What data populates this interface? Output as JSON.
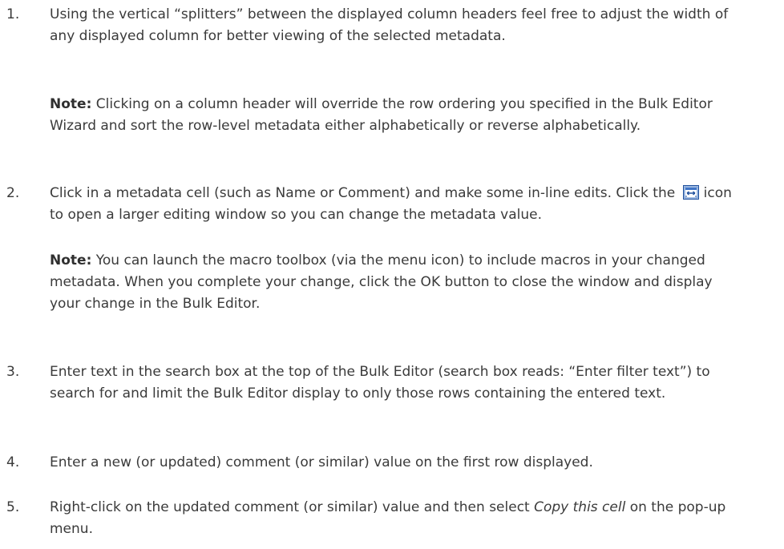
{
  "steps": [
    {
      "number": "1.",
      "text": "Using the vertical “splitters” between the displayed column headers feel free to adjust the width of any displayed column for better viewing of the selected metadata.",
      "note_label": "Note:",
      "note_text": " Clicking on a column header will override the row ordering you specified in the Bulk Editor Wizard and sort the row-level metadata either alphabetically or reverse alphabetically."
    },
    {
      "number": "2.",
      "text_before_icon": "Click in a metadata cell (such as Name or Comment) and make some in-line edits. Click the ",
      "icon": "expand-editor-icon",
      "text_after_icon": "icon to open a larger editing window so you can change the metadata value.",
      "note_label": "Note:",
      "note_text": " You can launch the macro toolbox (via the menu icon) to include macros in your changed metadata. When you complete your change, click the OK button to close the window and display your change in the Bulk Editor."
    },
    {
      "number": "3.",
      "text": "Enter text in the search box at the top of the Bulk Editor (search box reads: “Enter filter text”) to search for and limit the Bulk Editor display to only those rows containing the entered text."
    },
    {
      "number": "4.",
      "text": "Enter a new (or updated) comment (or similar) value on the first row displayed."
    },
    {
      "number": "5.",
      "text_before_italic": "Right-click on the updated comment (or similar) value and then select ",
      "italic": "Copy this cell",
      "text_after_italic": " on the pop-up menu."
    }
  ]
}
